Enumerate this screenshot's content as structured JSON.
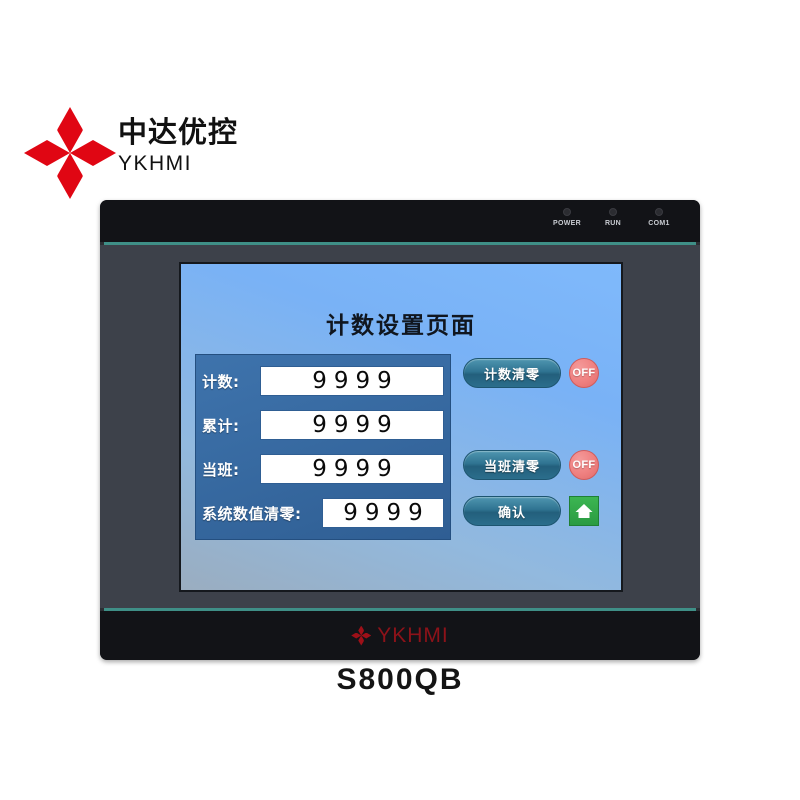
{
  "brand": {
    "logo_icon": "four-point-star-icon",
    "name_cn": "中达优控",
    "name_en": "YKHMI"
  },
  "device": {
    "model": "S800QB",
    "bottom_logo_icon": "four-point-star-icon",
    "bottom_logo_text": "YKHMI",
    "leds": [
      {
        "label": "POWER",
        "icon": "led-dot-icon"
      },
      {
        "label": "RUN",
        "icon": "led-dot-icon"
      },
      {
        "label": "COM1",
        "icon": "led-dot-icon"
      }
    ]
  },
  "screen": {
    "title": "计数设置页面",
    "rows": [
      {
        "label": "计数:",
        "value": "9999"
      },
      {
        "label": "累计:",
        "value": "9999"
      },
      {
        "label": "当班:",
        "value": "9999"
      },
      {
        "label": "系统数值清零:",
        "value": "9999"
      }
    ],
    "controls": {
      "count_reset_button": "计数清零",
      "count_reset_state": "OFF",
      "shift_reset_button": "当班清零",
      "shift_reset_state": "OFF",
      "confirm_button": "确认",
      "home_icon": "home-icon"
    }
  },
  "colors": {
    "brand_red": "#e00613",
    "panel_blue": "#36689f",
    "button_teal": "#2f7391",
    "off_salmon": "#ef8080",
    "home_green": "#2a9b42",
    "bezel_dark": "#3d414a",
    "bezel_black": "#121317",
    "accent_teal_line": "#3f8f87"
  }
}
